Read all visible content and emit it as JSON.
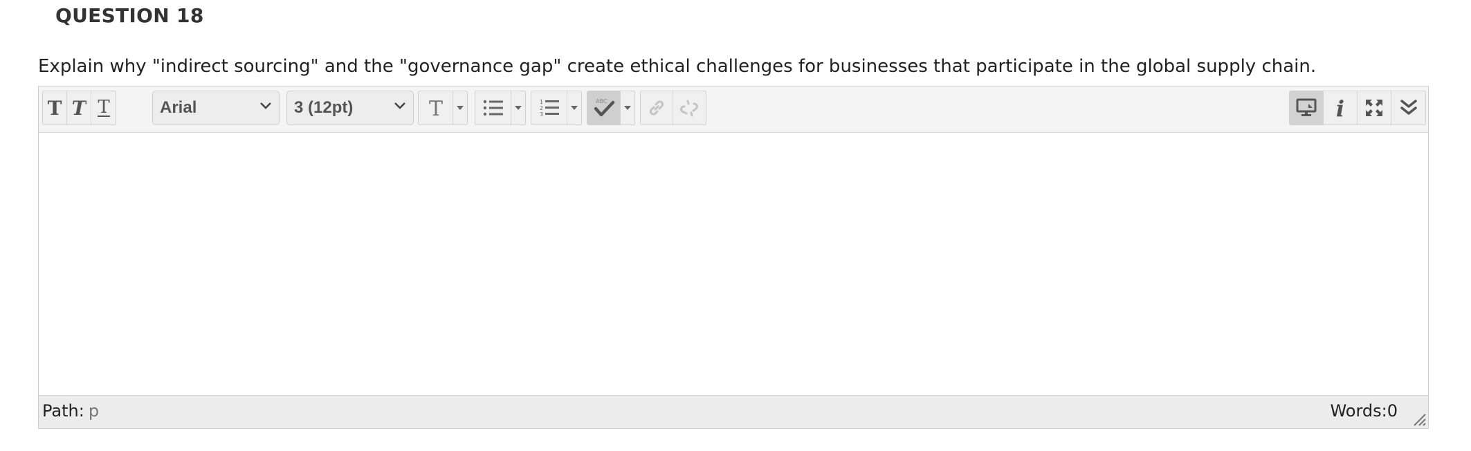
{
  "question": {
    "title": "QUESTION 18",
    "text": "Explain why \"indirect sourcing\" and the \"governance gap\" create ethical challenges for businesses that participate in the global supply chain."
  },
  "toolbar": {
    "bold_icon": "bold-T-icon",
    "italic_icon": "italic-T-icon",
    "underline_icon": "underline-T-icon",
    "font_family": "Arial",
    "font_size": "3 (12pt)",
    "spellcheck_icon_text": "ABC"
  },
  "editor": {
    "content": ""
  },
  "statusbar": {
    "path_label": "Path:",
    "path_value": "p",
    "word_count": "Words:0"
  },
  "colors": {
    "toolbar_bg": "#f4f4f4",
    "statusbar_bg": "#ececec",
    "border": "#cfcfcf",
    "icon": "#666666"
  }
}
